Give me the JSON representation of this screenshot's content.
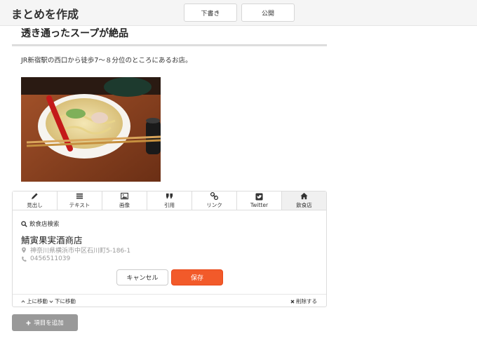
{
  "header": {
    "title": "まとめを作成",
    "draft_label": "下書き",
    "publish_label": "公開"
  },
  "article": {
    "heading": "透き通ったスープが絶品",
    "body": "JR新宿駅の西口から徒歩7〜８分位のところにあるお店。"
  },
  "toolbar": {
    "items": [
      {
        "label": "見出し",
        "icon": "pencil-icon"
      },
      {
        "label": "テキスト",
        "icon": "list-icon"
      },
      {
        "label": "画像",
        "icon": "image-icon"
      },
      {
        "label": "引用",
        "icon": "quote-icon"
      },
      {
        "label": "リンク",
        "icon": "link-icon"
      },
      {
        "label": "Twitter",
        "icon": "twitter-icon"
      },
      {
        "label": "飲食店",
        "icon": "home-icon"
      }
    ],
    "active_index": 6
  },
  "restaurant": {
    "search_label": "飲食店検索",
    "name": "鯖寅果実酒商店",
    "address": "神奈川県横浜市中区石川町5-186-1",
    "phone": "0456511039"
  },
  "actions": {
    "cancel_label": "キャンセル",
    "save_label": "保存"
  },
  "footer": {
    "move_up_label": "上に移動",
    "move_down_label": "下に移動",
    "delete_label": "削除する"
  },
  "add_item_label": "項目を追加",
  "colors": {
    "save_button": "#f25a2a",
    "add_button": "#999999",
    "topbar": "#f5f5f5"
  }
}
